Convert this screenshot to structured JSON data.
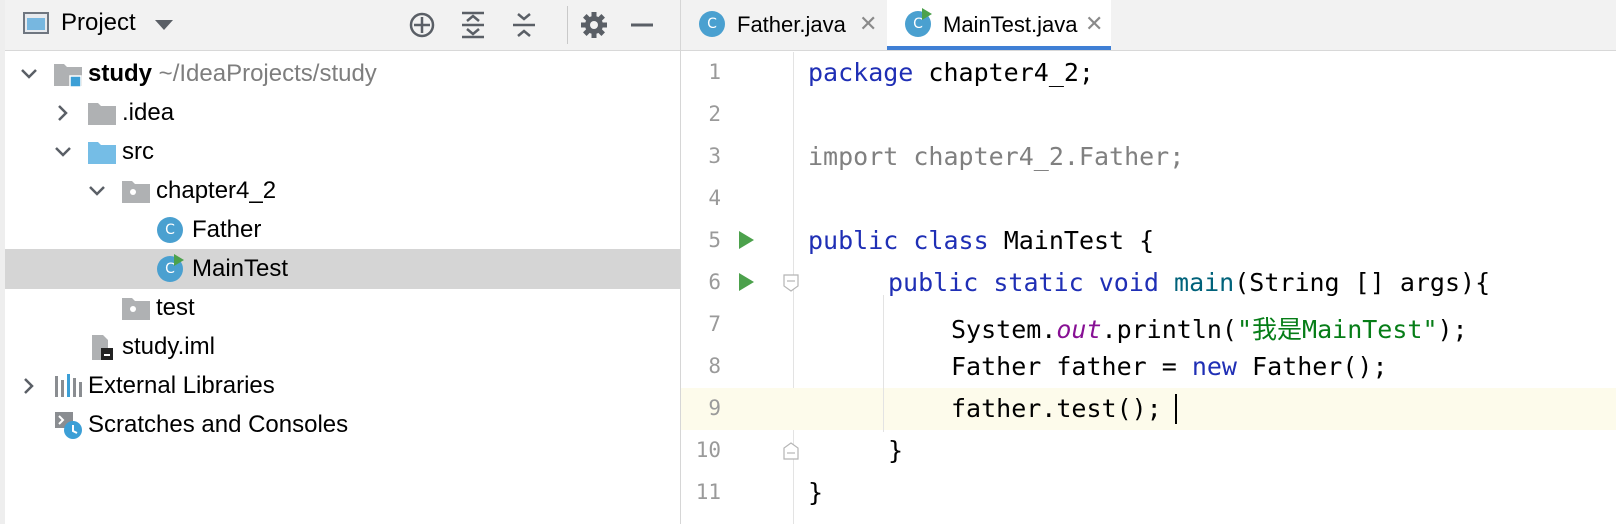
{
  "project_panel": {
    "title": "Project",
    "tree": [
      {
        "label": "study",
        "sub": " ~/IdeaProjects/study",
        "depth": 0,
        "expanded": true,
        "icon": "module-folder-icon"
      },
      {
        "label": ".idea",
        "depth": 1,
        "expanded": false,
        "icon": "folder-icon"
      },
      {
        "label": "src",
        "depth": 1,
        "expanded": true,
        "icon": "source-folder-icon"
      },
      {
        "label": "chapter4_2",
        "depth": 2,
        "expanded": true,
        "icon": "package-icon"
      },
      {
        "label": "Father",
        "depth": 3,
        "icon": "java-class-icon"
      },
      {
        "label": "MainTest",
        "depth": 3,
        "icon": "java-class-runnable-icon",
        "selected": true
      },
      {
        "label": "test",
        "depth": 2,
        "icon": "package-icon"
      },
      {
        "label": "study.iml",
        "depth": 1,
        "icon": "iml-file-icon"
      },
      {
        "label": "External Libraries",
        "depth": 0,
        "expanded": false,
        "icon": "libraries-icon"
      },
      {
        "label": "Scratches and Consoles",
        "depth": 0,
        "icon": "scratches-icon"
      }
    ]
  },
  "editor": {
    "tabs": [
      {
        "label": "Father.java",
        "active": false
      },
      {
        "label": "MainTest.java",
        "active": true
      }
    ],
    "current_line": 9,
    "line_numbers": [
      "1",
      "2",
      "3",
      "4",
      "5",
      "6",
      "7",
      "8",
      "9",
      "10",
      "11"
    ],
    "code": {
      "l1": {
        "kw": "package",
        "rest": " chapter4_2;"
      },
      "l3": {
        "text": "import chapter4_2.Father;"
      },
      "l5": {
        "kw1": "public",
        "kw2": "class",
        "rest": " MainTest {"
      },
      "l6": {
        "kw1": "public",
        "kw2": "static",
        "kw3": "void",
        "fn": "main",
        "rest": "(String [] args){"
      },
      "l7": {
        "a": "System.",
        "field": "out",
        "b": ".println(",
        "str": "\"我是MainTest\"",
        "c": ");"
      },
      "l8": {
        "a": "Father father = ",
        "kw": "new",
        "b": " Father();"
      },
      "l9": {
        "text": "father.test();"
      },
      "l10": {
        "text": "}"
      },
      "l11": {
        "text": "}"
      }
    }
  },
  "colors": {
    "keyword": "#1f2fb5",
    "string": "#067d17",
    "field": "#871094",
    "selection": "#d5d5d5",
    "active_tab_underline": "#3f7fd5",
    "run_marker": "#4ca14c"
  }
}
